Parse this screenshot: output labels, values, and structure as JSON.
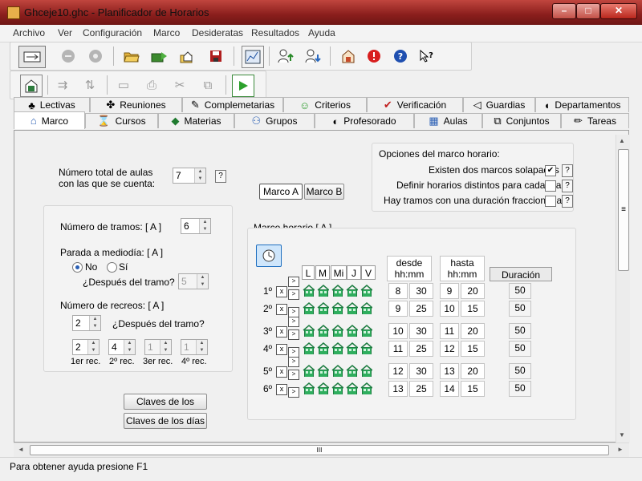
{
  "window": {
    "title": "Ghceje10.ghc - Planificador de Horarios",
    "min": "–",
    "max": "□",
    "close": "✕"
  },
  "menu": [
    "Archivo",
    "Ver",
    "Configuración",
    "Marco",
    "Desideratas",
    "Resultados",
    "Ayuda"
  ],
  "tabs_top": [
    {
      "label": "Lectivas",
      "icon": "♣"
    },
    {
      "label": "Reuniones",
      "icon": "✤"
    },
    {
      "label": "Complemetarias",
      "icon": "✎"
    },
    {
      "label": "Criterios",
      "icon": "☺"
    },
    {
      "label": "Verificación",
      "icon": "✔"
    },
    {
      "label": "Guardias",
      "icon": "◁"
    },
    {
      "label": "Departamentos",
      "icon": "◖"
    }
  ],
  "tabs_bottom": [
    {
      "label": "Marco",
      "icon": "⌂"
    },
    {
      "label": "Cursos",
      "icon": "⌛"
    },
    {
      "label": "Materias",
      "icon": "◆"
    },
    {
      "label": "Grupos",
      "icon": "⚇"
    },
    {
      "label": "Profesorado",
      "icon": "◐"
    },
    {
      "label": "Aulas",
      "icon": "▦"
    },
    {
      "label": "Conjuntos",
      "icon": "⧉"
    },
    {
      "label": "Tareas",
      "icon": "✏"
    }
  ],
  "aulas": {
    "label1": "Número total de aulas",
    "label2": "con las que se cuenta:",
    "value": "7",
    "help": "?"
  },
  "tramos": {
    "label": "Número de tramos: [ A ]",
    "value": "6"
  },
  "parada": {
    "label": "Parada a mediodía: [ A ]",
    "no": "No",
    "si": "Sí",
    "despues": "¿Después del tramo?",
    "despues_value": "5"
  },
  "recreos": {
    "label": "Número de recreos: [ A ]",
    "value": "2",
    "despues": "¿Después del tramo?",
    "values": [
      "2",
      "4",
      "1",
      "1"
    ],
    "labels": [
      "1er rec.",
      "2º rec.",
      "3er rec.",
      "4º rec."
    ]
  },
  "buttons": {
    "claves_tramos": "Claves de los tramos",
    "claves_dias": "Claves de los días"
  },
  "marco_tabs": {
    "a": "Marco A",
    "b": "Marco B"
  },
  "opciones": {
    "title": "Opciones del marco horario:",
    "items": [
      {
        "label": "Existen dos marcos solapados",
        "checked": "✔"
      },
      {
        "label": "Definir horarios distintos para cada día",
        "checked": ""
      },
      {
        "label": "Hay tramos con una duración fraccionada",
        "checked": ""
      }
    ],
    "help": "?"
  },
  "marco_horario": {
    "title": "Marco horario [ A ]",
    "days": [
      "L",
      "M",
      "Mi",
      "J",
      "V"
    ],
    "desde": "desde",
    "hasta": "hasta",
    "hhmm": "hh:mm",
    "duracion": "Duración",
    "x": "x",
    "arrow": ">",
    "rows": [
      {
        "label": "1º",
        "dh": "8",
        "dm": "30",
        "hh": "9",
        "hm": "20",
        "dur": "50"
      },
      {
        "label": "2º",
        "dh": "9",
        "dm": "25",
        "hh": "10",
        "hm": "15",
        "dur": "50"
      },
      {
        "label": "3º",
        "dh": "10",
        "dm": "30",
        "hh": "11",
        "hm": "20",
        "dur": "50"
      },
      {
        "label": "4º",
        "dh": "11",
        "dm": "25",
        "hh": "12",
        "hm": "15",
        "dur": "50"
      },
      {
        "label": "5º",
        "dh": "12",
        "dm": "30",
        "hh": "13",
        "hm": "20",
        "dur": "50"
      },
      {
        "label": "6º",
        "dh": "13",
        "dm": "25",
        "hh": "14",
        "hm": "15",
        "dur": "50"
      }
    ]
  },
  "status": "Para obtener ayuda presione F1",
  "scroll": {
    "grip": "≡",
    "h_grip": "III",
    "up": "▲",
    "down": "▼",
    "left": "◄",
    "right": "►"
  },
  "colors": {
    "house": "#2fae5e",
    "house_roof": "#1d7d41",
    "accent": "#2a5fb4"
  }
}
